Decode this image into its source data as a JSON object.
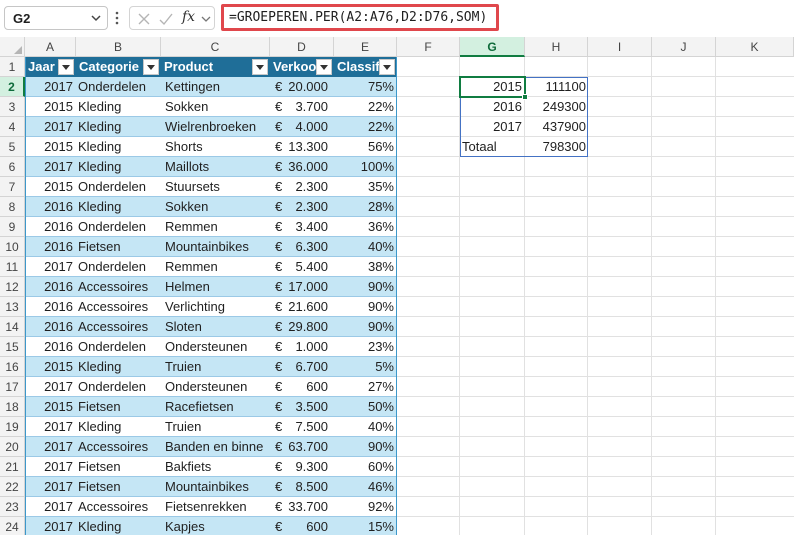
{
  "formula_bar": {
    "name_box": "G2",
    "formula": "=GROEPEREN.PER(A2:A76,D2:D76,SOM)",
    "fx_label": "fx"
  },
  "columns": [
    "A",
    "B",
    "C",
    "D",
    "E",
    "F",
    "G",
    "H",
    "I",
    "J",
    "K"
  ],
  "selected_column": "G",
  "rows": [
    "1",
    "2",
    "3",
    "4",
    "5",
    "6",
    "7",
    "8",
    "9",
    "10",
    "11",
    "12",
    "13",
    "14",
    "15",
    "16",
    "17",
    "18",
    "19",
    "20",
    "21",
    "22",
    "23",
    "24"
  ],
  "selected_row": "2",
  "table": {
    "headers": [
      "Jaar",
      "Categorie",
      "Product",
      "Verkoo",
      "Classifi"
    ],
    "rows": [
      {
        "jaar": "2017",
        "cat": "Onderdelen",
        "prod": "Kettingen",
        "eur": "€",
        "amt": "20.000",
        "pct": "75%"
      },
      {
        "jaar": "2015",
        "cat": "Kleding",
        "prod": "Sokken",
        "eur": "€",
        "amt": "3.700",
        "pct": "22%"
      },
      {
        "jaar": "2017",
        "cat": "Kleding",
        "prod": "Wielrenbroeken",
        "eur": "€",
        "amt": "4.000",
        "pct": "22%"
      },
      {
        "jaar": "2015",
        "cat": "Kleding",
        "prod": "Shorts",
        "eur": "€",
        "amt": "13.300",
        "pct": "56%"
      },
      {
        "jaar": "2017",
        "cat": "Kleding",
        "prod": "Maillots",
        "eur": "€",
        "amt": "36.000",
        "pct": "100%"
      },
      {
        "jaar": "2015",
        "cat": "Onderdelen",
        "prod": "Stuursets",
        "eur": "€",
        "amt": "2.300",
        "pct": "35%"
      },
      {
        "jaar": "2016",
        "cat": "Kleding",
        "prod": "Sokken",
        "eur": "€",
        "amt": "2.300",
        "pct": "28%"
      },
      {
        "jaar": "2016",
        "cat": "Onderdelen",
        "prod": "Remmen",
        "eur": "€",
        "amt": "3.400",
        "pct": "36%"
      },
      {
        "jaar": "2016",
        "cat": "Fietsen",
        "prod": "Mountainbikes",
        "eur": "€",
        "amt": "6.300",
        "pct": "40%"
      },
      {
        "jaar": "2017",
        "cat": "Onderdelen",
        "prod": "Remmen",
        "eur": "€",
        "amt": "5.400",
        "pct": "38%"
      },
      {
        "jaar": "2016",
        "cat": "Accessoires",
        "prod": "Helmen",
        "eur": "€",
        "amt": "17.000",
        "pct": "90%"
      },
      {
        "jaar": "2016",
        "cat": "Accessoires",
        "prod": "Verlichting",
        "eur": "€",
        "amt": "21.600",
        "pct": "90%"
      },
      {
        "jaar": "2016",
        "cat": "Accessoires",
        "prod": "Sloten",
        "eur": "€",
        "amt": "29.800",
        "pct": "90%"
      },
      {
        "jaar": "2016",
        "cat": "Onderdelen",
        "prod": "Ondersteunen",
        "eur": "€",
        "amt": "1.000",
        "pct": "23%"
      },
      {
        "jaar": "2015",
        "cat": "Kleding",
        "prod": "Truien",
        "eur": "€",
        "amt": "6.700",
        "pct": "5%"
      },
      {
        "jaar": "2017",
        "cat": "Onderdelen",
        "prod": "Ondersteunen",
        "eur": "€",
        "amt": "600",
        "pct": "27%"
      },
      {
        "jaar": "2015",
        "cat": "Fietsen",
        "prod": "Racefietsen",
        "eur": "€",
        "amt": "3.500",
        "pct": "50%"
      },
      {
        "jaar": "2017",
        "cat": "Kleding",
        "prod": "Truien",
        "eur": "€",
        "amt": "7.500",
        "pct": "40%"
      },
      {
        "jaar": "2017",
        "cat": "Accessoires",
        "prod": "Banden en binne",
        "eur": "€",
        "amt": "63.700",
        "pct": "90%"
      },
      {
        "jaar": "2017",
        "cat": "Fietsen",
        "prod": "Bakfiets",
        "eur": "€",
        "amt": "9.300",
        "pct": "60%"
      },
      {
        "jaar": "2017",
        "cat": "Fietsen",
        "prod": "Mountainbikes",
        "eur": "€",
        "amt": "8.500",
        "pct": "46%"
      },
      {
        "jaar": "2017",
        "cat": "Accessoires",
        "prod": "Fietsenrekken",
        "eur": "€",
        "amt": "33.700",
        "pct": "92%"
      },
      {
        "jaar": "2017",
        "cat": "Kleding",
        "prod": "Kapjes",
        "eur": "€",
        "amt": "600",
        "pct": "15%"
      }
    ]
  },
  "summary": {
    "rows": [
      {
        "label": "2015",
        "value": "111100"
      },
      {
        "label": "2016",
        "value": "249300"
      },
      {
        "label": "2017",
        "value": "437900"
      },
      {
        "label": "Totaal",
        "value": "798300"
      }
    ]
  },
  "colors": {
    "table_header": "#1f6e98",
    "band": "#c5e6f5",
    "highlight_border": "#e0474c",
    "selection": "#107c41"
  }
}
